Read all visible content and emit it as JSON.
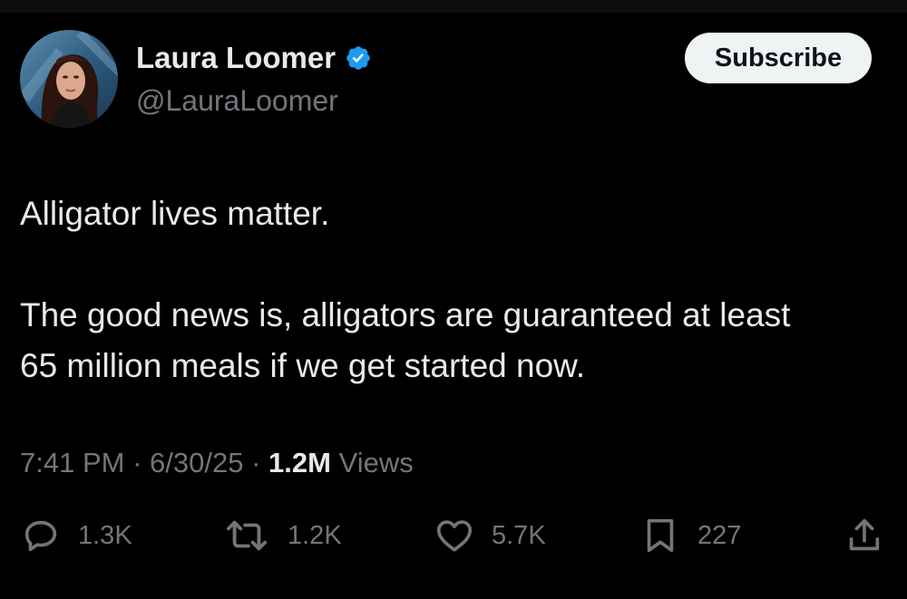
{
  "author": {
    "display_name": "Laura Loomer",
    "handle": "@LauraLoomer",
    "verified_icon": "verified-badge-icon",
    "avatar": "profile-photo"
  },
  "header": {
    "subscribe_label": "Subscribe"
  },
  "tweet": {
    "paragraphs": [
      "Alligator lives matter.",
      "The good news is, alligators are guaranteed at least",
      "65 million meals if we get started now."
    ]
  },
  "meta": {
    "time": "7:41 PM",
    "separator": "·",
    "date": "6/30/25",
    "views_count": "1.2M",
    "views_label": "Views"
  },
  "actions": {
    "replies": {
      "icon": "reply-icon",
      "count": "1.3K"
    },
    "reposts": {
      "icon": "repost-icon",
      "count": "1.2K"
    },
    "likes": {
      "icon": "heart-icon",
      "count": "5.7K"
    },
    "bookmarks": {
      "icon": "bookmark-icon",
      "count": "227"
    },
    "share": {
      "icon": "share-icon"
    }
  },
  "colors": {
    "background": "#000000",
    "primary_text": "#e7e9ea",
    "secondary_text": "#71767b",
    "verified_blue": "#1d9bf0",
    "button_bg": "#eff3f4",
    "button_text": "#0f1419"
  }
}
